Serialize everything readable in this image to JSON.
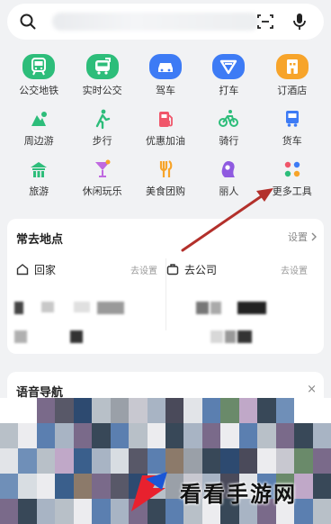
{
  "search": {
    "placeholder": ""
  },
  "tools": [
    {
      "label": "公交地铁",
      "icon": "bus-subway-icon",
      "color": "#2dbd7a"
    },
    {
      "label": "实时公交",
      "icon": "realtime-bus-icon",
      "color": "#2dbd7a"
    },
    {
      "label": "驾车",
      "icon": "car-icon",
      "color": "#3d7bf5"
    },
    {
      "label": "打车",
      "icon": "taxi-icon",
      "color": "#3d7bf5"
    },
    {
      "label": "订酒店",
      "icon": "hotel-icon",
      "color": "#f7a42a"
    },
    {
      "label": "周边游",
      "icon": "nearby-travel-icon",
      "color": "#2dbd7a"
    },
    {
      "label": "步行",
      "icon": "walk-icon",
      "color": "#2dbd7a"
    },
    {
      "label": "优惠加油",
      "icon": "fuel-icon",
      "color": "#f0566a"
    },
    {
      "label": "骑行",
      "icon": "bike-icon",
      "color": "#2dbd7a"
    },
    {
      "label": "货车",
      "icon": "truck-icon",
      "color": "#3d7bf5"
    },
    {
      "label": "旅游",
      "icon": "travel-icon",
      "color": "#2dbd7a"
    },
    {
      "label": "休闲玩乐",
      "icon": "cocktail-icon",
      "color": "#c069e0"
    },
    {
      "label": "美食团购",
      "icon": "food-icon",
      "color": "#f7a42a"
    },
    {
      "label": "丽人",
      "icon": "beauty-icon",
      "color": "#8f5ae0"
    },
    {
      "label": "更多工具",
      "icon": "more-tools-icon",
      "color": "#f0566a"
    }
  ],
  "frequent": {
    "title": "常去地点",
    "settings_label": "设置",
    "home": {
      "label": "回家",
      "action": "去设置"
    },
    "work": {
      "label": "去公司",
      "action": "去设置"
    }
  },
  "voice": {
    "title": "语音导航",
    "close": "×"
  },
  "watermark": {
    "text": "看看手游网"
  },
  "colors": {
    "arrow": "#b3302b"
  }
}
